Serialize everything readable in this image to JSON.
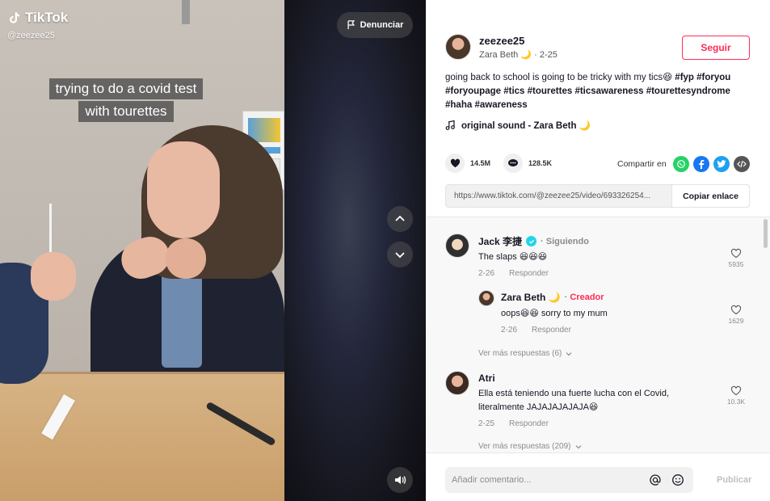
{
  "video": {
    "brand": "TikTok",
    "handle": "@zeezee25",
    "caption_lines": [
      "trying to do a covid test",
      "with tourettes"
    ],
    "report_label": "Denunciar",
    "icons": {
      "up": "chevron-up-icon",
      "down": "chevron-down-icon",
      "volume": "volume-icon",
      "flag": "flag-icon"
    }
  },
  "author": {
    "username": "zeezee25",
    "display_name": "Zara Beth",
    "moon": "🌙",
    "date": "2-25",
    "follow_label": "Seguir"
  },
  "description": {
    "text": "going back to school is going to be tricky with my tics😆",
    "tags": [
      "#fyp",
      "#foryou",
      "#foryoupage",
      "#tics",
      "#tourettes",
      "#ticsawareness",
      "#tourettesyndrome",
      "#haha",
      "#awareness"
    ]
  },
  "sound": {
    "label": "original sound - Zara Beth 🌙"
  },
  "stats": {
    "likes": "14.5M",
    "comments": "128.5K"
  },
  "share": {
    "label": "Compartir en",
    "targets": [
      "whatsapp",
      "facebook",
      "twitter",
      "embed"
    ]
  },
  "link": {
    "url": "https://www.tiktok.com/@zeezee25/video/693326254...",
    "copy_label": "Copiar enlace"
  },
  "comments": [
    {
      "name": "Jack 李捷",
      "status": "Siguiendo",
      "text": "The slaps 😆😆😆",
      "date": "2-26",
      "reply_label": "Responder",
      "likes": "5935"
    },
    {
      "name": "Zara Beth 🌙",
      "status": "Creador",
      "text": "oops😆😆 sorry to my mum",
      "date": "2-26",
      "reply_label": "Responder",
      "likes": "1629"
    },
    {
      "name": "Atri",
      "text": "Ella está teniendo una fuerte lucha con el Covid, literalmente JAJAJAJAJAJA😆",
      "date": "2-25",
      "reply_label": "Responder",
      "likes": "10.3K"
    }
  ],
  "more_replies": [
    "Ver más respuestas (6)",
    "Ver más respuestas (209)"
  ],
  "comment_bar": {
    "placeholder": "Añadir comentario...",
    "publish_label": "Publicar"
  },
  "colors": {
    "accent": "#fe2c55",
    "verified": "#20d5ec",
    "whatsapp": "#25d366",
    "facebook": "#1877f2",
    "twitter": "#1da1f2",
    "embed": "#555555"
  }
}
